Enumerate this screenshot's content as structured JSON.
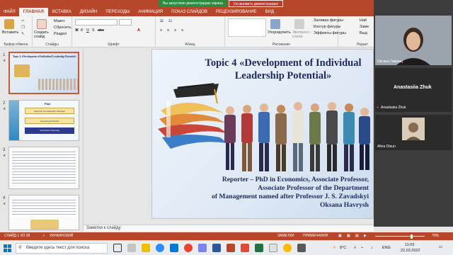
{
  "titlebar": {
    "share_message": "Вы запустили демонстрацию экрана",
    "stop_share": "Остановить демонстрацию"
  },
  "ribbon_tabs": [
    "ФАЙЛ",
    "ГЛАВНАЯ",
    "ВСТАВКА",
    "ДИЗАЙН",
    "ПЕРЕХОДЫ",
    "АНИМАЦИЯ",
    "ПОКАЗ СЛАЙДОВ",
    "РЕЦЕНЗИРОВАНИЕ",
    "ВИД"
  ],
  "ribbon": {
    "paste": "Вставить",
    "clipboard_label": "Буфер обмена",
    "new_slide": "Создать слайд",
    "layout": "Макет",
    "reset": "Сбросить",
    "section": "Раздел",
    "slides_label": "Слайды",
    "font_label": "Шрифт",
    "paragraph_label": "Абзац",
    "arrange": "Упорядочить",
    "quick_styles": "Экспресс-стили",
    "shape_fill": "Заливка фигуры",
    "shape_outline": "Контур фигуры",
    "shape_effects": "Эффекты фигуры",
    "drawing_label": "Рисование",
    "find": "Най",
    "replace": "Заме",
    "select": "Выд",
    "editing_label": "Редакт"
  },
  "video": {
    "participant1_name": "Оксана Гаврищ",
    "participant2_name": "Anastasiia Zhuk",
    "participant2_label": "Anastasiia Zhuk",
    "participant3_name": "Alina Otsun"
  },
  "thumbnails": [
    {
      "number": "1",
      "title": "Topic 4 «Development of Individual Leadership Potential»"
    },
    {
      "number": "2",
      "title": "Plan",
      "items": [
        "Essence of Leadership Potential",
        "Assessing Potential",
        "Succession Planning"
      ]
    },
    {
      "number": "3",
      "title": ""
    },
    {
      "number": "4",
      "title": ""
    }
  ],
  "slide": {
    "title": "Topic 4 «Development of Individual Leadership Potential»",
    "title_line1": "Topic 4 «Development of Individual",
    "title_line2": "Leadership Potential»",
    "line1": "Reporter – PhD in Economics, Associate Professor,",
    "line2": "Associate Professor of the Department",
    "line3": "of Management named after Professor J. S. Zavadskyi",
    "line4": "Oksana Havrysh"
  },
  "notes_placeholder": "Заметки к слайду",
  "status": {
    "slide_counter": "СЛАЙД 1 ИЗ 28",
    "language": "УКРАИНСКИЙ",
    "notes": "ЗАМЕТКИ",
    "comments": "ПРИМЕЧАНИЯ",
    "zoom": "70%"
  },
  "taskbar": {
    "search_placeholder": "Введите здесь текст для поиска",
    "temperature": "8°C",
    "language": "ENG",
    "time": "11:03",
    "date": "22.03.2022"
  },
  "colors": {
    "accent": "#b7472a",
    "title_text": "#1f2a5a"
  }
}
